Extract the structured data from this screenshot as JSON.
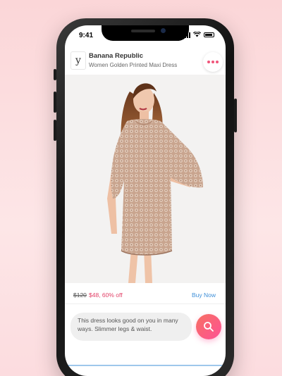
{
  "status_bar": {
    "time": "9:41",
    "signal_icon": "signal-icon",
    "wifi_icon": "wifi-icon",
    "battery_icon": "battery-icon"
  },
  "header": {
    "logo_glyph": "y",
    "brand": "Banana Republic",
    "product": "Women Golden Printed Maxi Dress",
    "menu_icon": "more-dots-icon"
  },
  "product_image": {
    "alt": "woman in golden sequin dress"
  },
  "price": {
    "old": "$120",
    "new": "$48, 60% off",
    "buy_label": "Buy Now"
  },
  "chat": {
    "message": "This dress looks good on you in many ways. Slimmer legs & waist.",
    "search_icon": "search-icon"
  },
  "colors": {
    "accent": "#fe5196",
    "link": "#3e8fd8",
    "price": "#e24067"
  }
}
